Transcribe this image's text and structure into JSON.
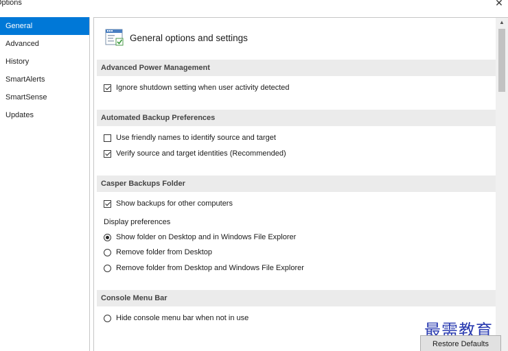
{
  "window": {
    "title": "Options",
    "close_glyph": "✕"
  },
  "sidebar": {
    "items": [
      {
        "label": "General",
        "selected": true
      },
      {
        "label": "Advanced",
        "selected": false
      },
      {
        "label": "History",
        "selected": false
      },
      {
        "label": "SmartAlerts",
        "selected": false
      },
      {
        "label": "SmartSense",
        "selected": false
      },
      {
        "label": "Updates",
        "selected": false
      }
    ]
  },
  "main": {
    "title": "General options and settings",
    "title_icon": "settings-window-icon",
    "sections": [
      {
        "heading": "Advanced Power Management"
      },
      {
        "heading": "Automated Backup Preferences"
      },
      {
        "heading": "Casper Backups Folder"
      },
      {
        "heading": "Console Menu Bar"
      }
    ],
    "options": {
      "ignore_shutdown": {
        "label": "Ignore shutdown setting when user activity detected",
        "checked": true
      },
      "friendly_names": {
        "label": "Use friendly names to identify source and target",
        "checked": false
      },
      "verify_identities": {
        "label": "Verify source and target identities (Recommended)",
        "checked": true
      },
      "show_backups": {
        "label": "Show backups for other computers",
        "checked": true
      },
      "display_preferences_label": "Display preferences",
      "folder_show_all": {
        "label": "Show folder on Desktop and in Windows File Explorer",
        "selected": true
      },
      "folder_remove_desktop": {
        "label": "Remove folder from Desktop",
        "selected": false
      },
      "folder_remove_all": {
        "label": "Remove folder from Desktop and Windows File Explorer",
        "selected": false
      },
      "hide_menu_bar": {
        "label": "Hide console menu bar when not in use",
        "selected": false
      }
    }
  },
  "footer": {
    "restore_label": "Restore Defaults"
  },
  "watermark": {
    "text": "最需教育"
  },
  "colors": {
    "accent": "#0078d7",
    "section_bg": "#ebebeb",
    "watermark": "#2a3bb0"
  }
}
